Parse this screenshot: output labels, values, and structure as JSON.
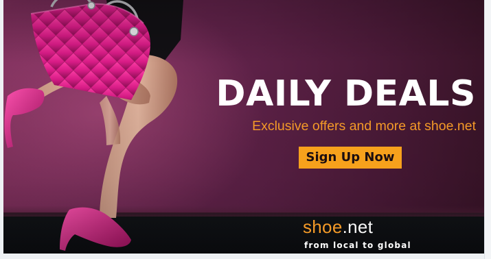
{
  "banner": {
    "headline": "DAILY DEALS",
    "tagline": "Exclusive offers and more at shoe.net",
    "cta_label": "Sign Up Now",
    "logo": {
      "brand": "shoe",
      "dot": ".",
      "tld": "net"
    },
    "slogan": "from local to global"
  },
  "colors": {
    "accent_orange": "#f7a11c",
    "headline": "#ffffff",
    "background_magenta": "#5d2147",
    "handbag_pink": "#d81b86",
    "footer": "#0b0d10"
  },
  "images": {
    "photo": "woman-legs-pink-heels-pink-quilted-handbag"
  }
}
